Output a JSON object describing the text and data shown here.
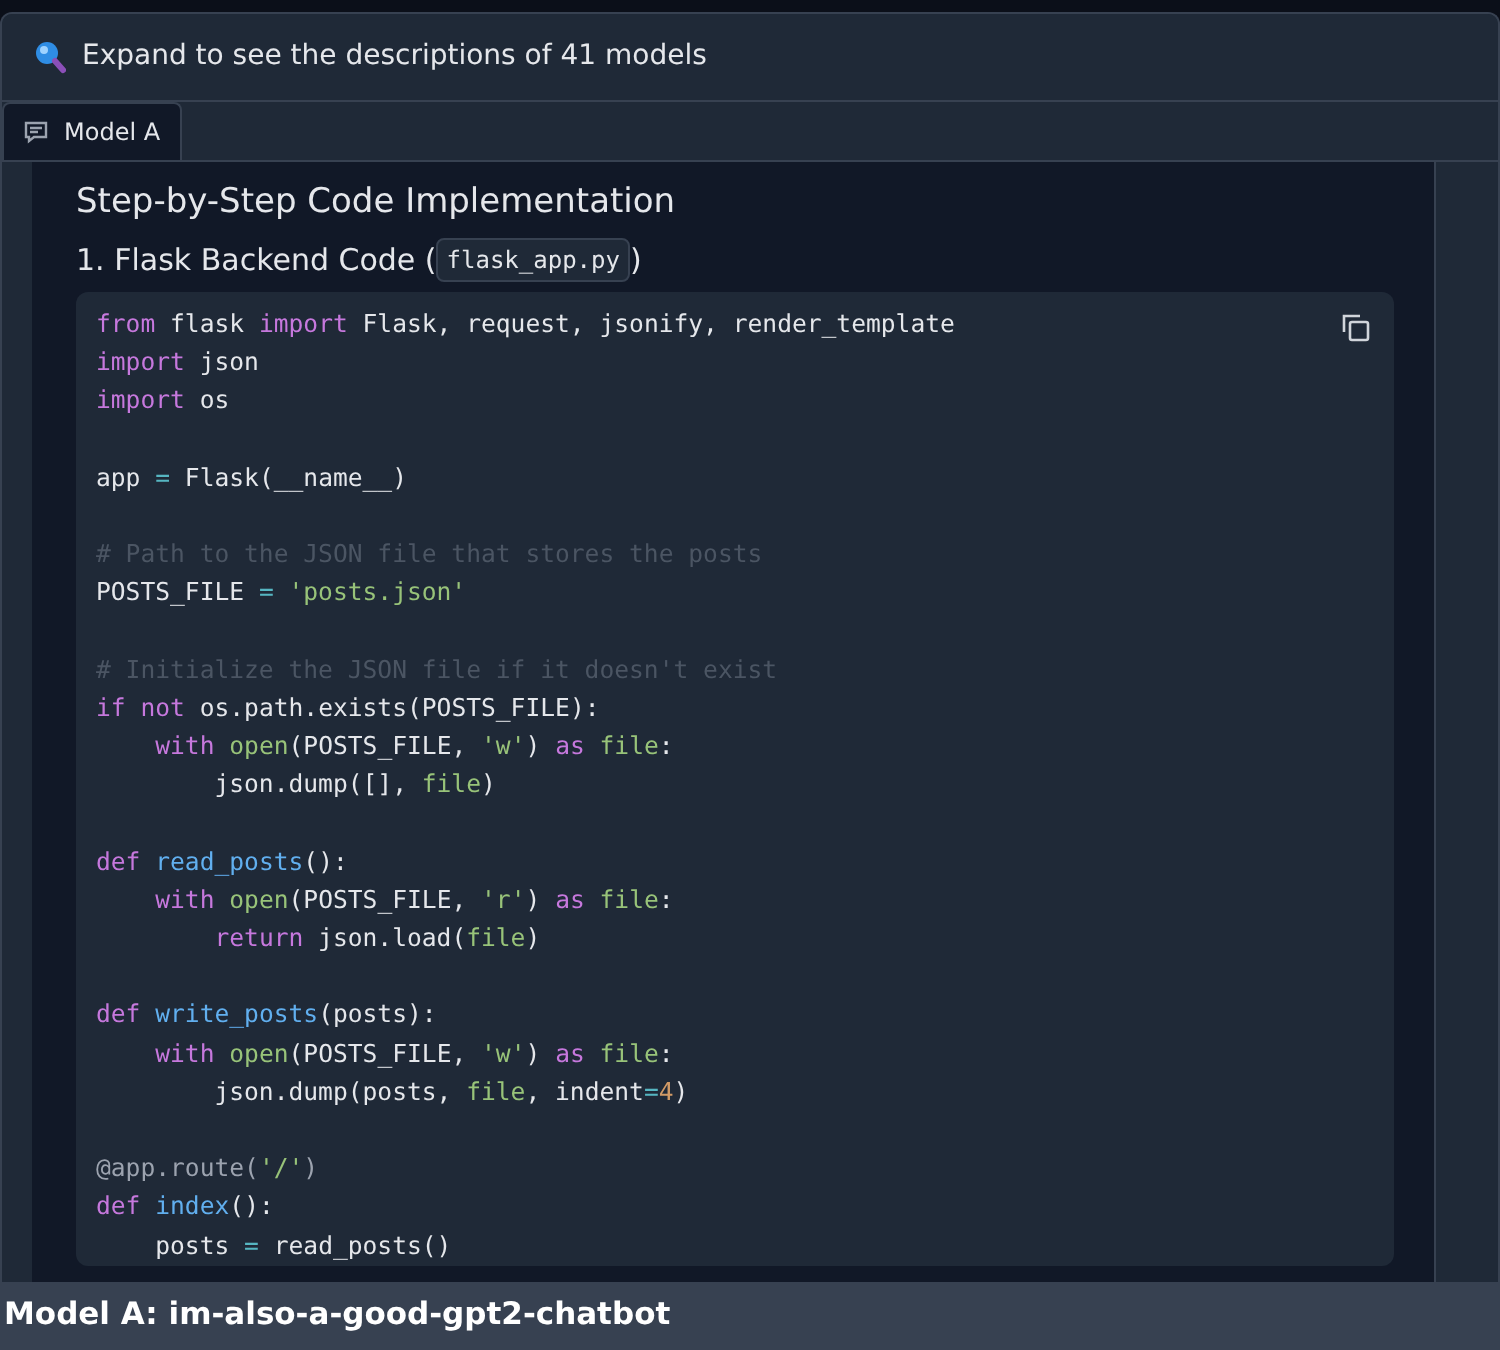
{
  "accordion": {
    "title": "Expand to see the descriptions of 41 models"
  },
  "tabs": [
    {
      "label": "Model A",
      "selected": true
    }
  ],
  "message": {
    "heading": "Step-by-Step Code Implementation",
    "subheading": {
      "text": "1. Flask Backend Code (",
      "code": "flask_app.py",
      "suffix": ")"
    }
  },
  "code_block": {
    "lines": [
      {
        "kind": "code",
        "text": "from flask import Flask, request, jsonify, render_template"
      },
      {
        "kind": "code",
        "text": "import json"
      },
      {
        "kind": "code",
        "text": "import os"
      },
      {
        "kind": "blank"
      },
      {
        "kind": "code",
        "text": "app = Flask(__name__)"
      },
      {
        "kind": "blank"
      },
      {
        "kind": "code",
        "text": "# Path to the JSON file that stores the posts"
      },
      {
        "kind": "code",
        "text": "POSTS_FILE = 'posts.json'"
      },
      {
        "kind": "blank"
      },
      {
        "kind": "code",
        "text": "# Initialize the JSON file if it doesn't exist"
      },
      {
        "kind": "code",
        "text": "if not os.path.exists(POSTS_FILE):"
      },
      {
        "kind": "code",
        "text": "    with open(POSTS_FILE, 'w') as file:"
      },
      {
        "kind": "code",
        "text": "        json.dump([], file)"
      },
      {
        "kind": "blank"
      },
      {
        "kind": "code",
        "text": "def read_posts():"
      },
      {
        "kind": "code",
        "text": "    with open(POSTS_FILE, 'r') as file:"
      },
      {
        "kind": "code",
        "text": "        return json.load(file)"
      },
      {
        "kind": "blank"
      },
      {
        "kind": "code",
        "text": "def write_posts(posts):"
      },
      {
        "kind": "code",
        "text": "    with open(POSTS_FILE, 'w') as file:"
      },
      {
        "kind": "code",
        "text": "        json.dump(posts, file, indent=4)"
      },
      {
        "kind": "blank"
      },
      {
        "kind": "code",
        "text": "@app.route('/')"
      },
      {
        "kind": "code",
        "text": "def index():"
      },
      {
        "kind": "code",
        "text": "    posts = read_posts()"
      }
    ]
  },
  "footer": {
    "label": "Model A: im-also-a-good-gpt2-chatbot"
  }
}
